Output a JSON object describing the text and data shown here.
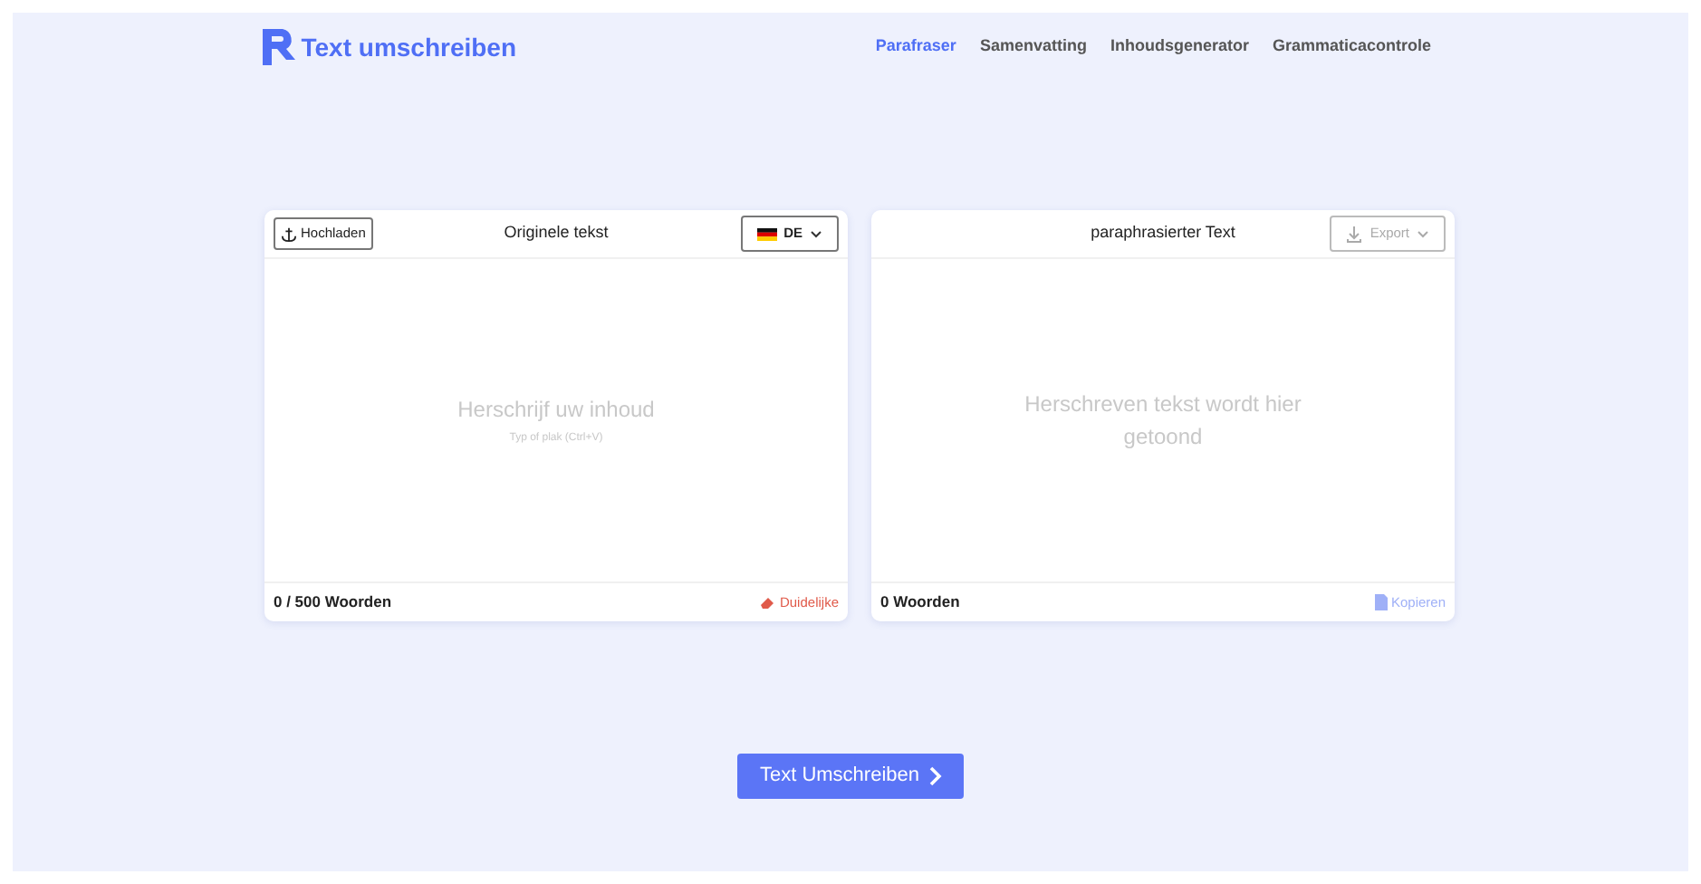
{
  "brand": {
    "name": "Text umschreiben"
  },
  "nav": [
    {
      "label": "Parafraser",
      "selected": true
    },
    {
      "label": "Samenvatting",
      "selected": false
    },
    {
      "label": "Inhoudsgenerator",
      "selected": false
    },
    {
      "label": "Grammaticacontrole",
      "selected": false
    }
  ],
  "input_panel": {
    "upload_button": "Hochladen",
    "title": "Originele tekst",
    "language": "DE",
    "placeholder": "Herschrijf uw inhoud",
    "hint": "Typ of plak (Ctrl+V)",
    "word_count": "0 / 500 Woorden",
    "clear_button": "Duidelijke"
  },
  "output_panel": {
    "title": "paraphrasierter Text",
    "export_button": "Export",
    "export_disabled": true,
    "placeholder": "Herschreven tekst wordt hier getoond",
    "word_count": "0 Woorden",
    "copy_button": "Kopieren",
    "copy_disabled": true
  },
  "submit_button": "Text Umschreiben"
}
